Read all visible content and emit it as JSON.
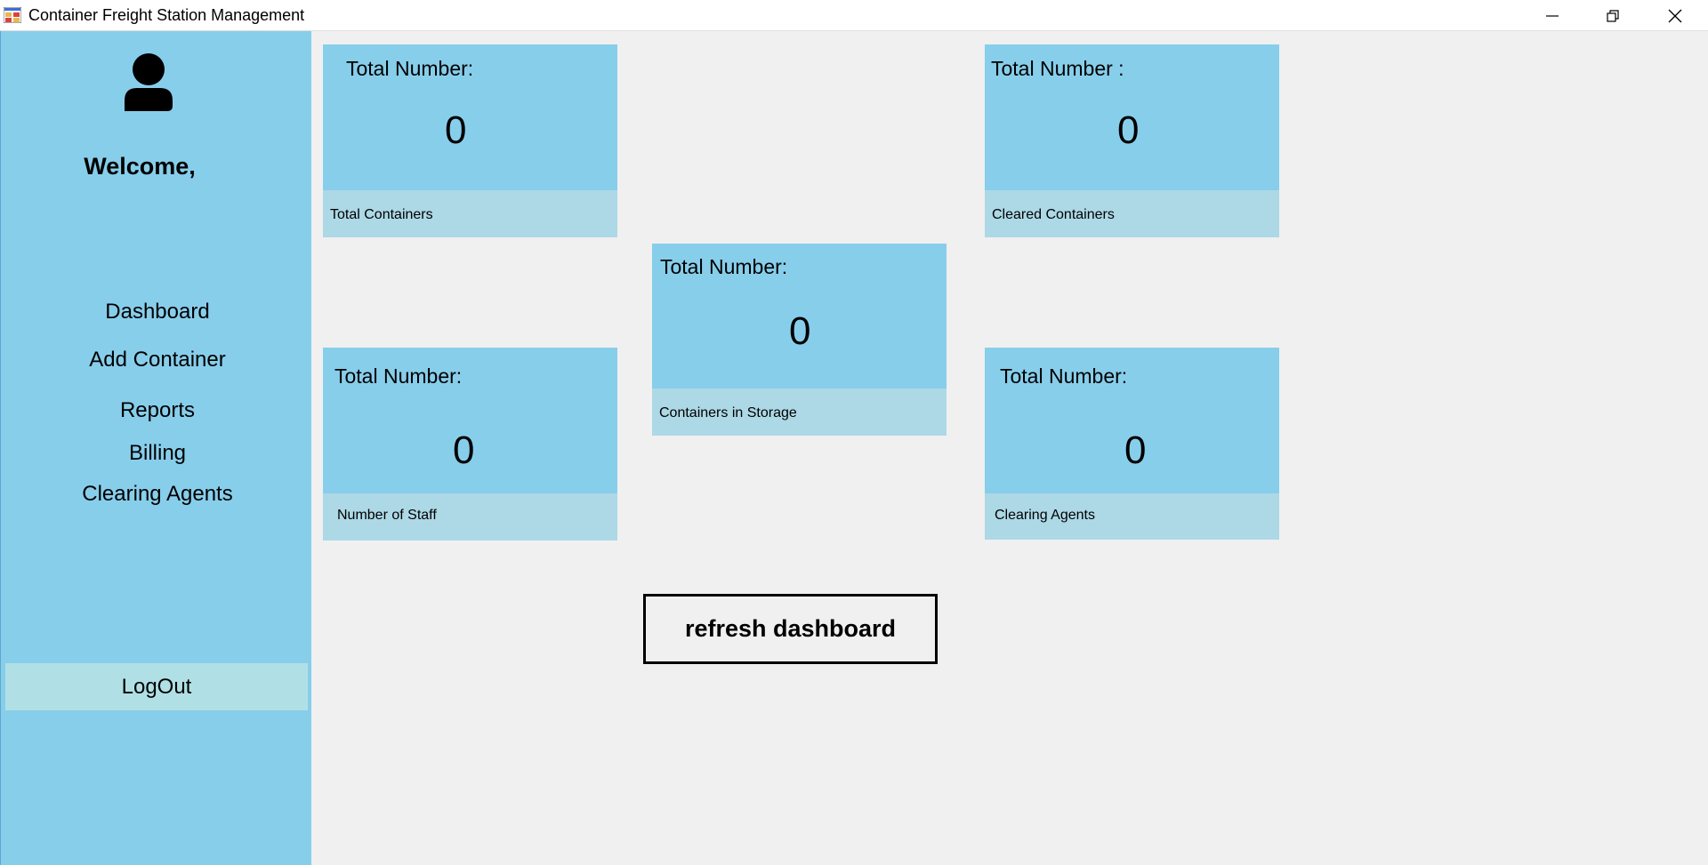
{
  "window": {
    "title": "Container Freight Station Management",
    "icon": "app-icon"
  },
  "sidebar": {
    "welcome": "Welcome,",
    "avatar_icon": "user-icon",
    "nav": [
      {
        "label": "Dashboard"
      },
      {
        "label": "Add Container"
      },
      {
        "label": "Reports"
      },
      {
        "label": "Billing"
      },
      {
        "label": "Clearing Agents"
      }
    ],
    "logout": "LogOut"
  },
  "cards": [
    {
      "header": "Total Number:",
      "value": "0",
      "caption": "Total Containers"
    },
    {
      "header": "Total Number :",
      "value": "0",
      "caption": "Cleared Containers"
    },
    {
      "header": "Total Number:",
      "value": "0",
      "caption": "Containers in Storage"
    },
    {
      "header": "Total Number:",
      "value": "0",
      "caption": "Number of Staff"
    },
    {
      "header": "Total Number:",
      "value": "0",
      "caption": "Clearing Agents"
    }
  ],
  "refresh_button": "refresh dashboard",
  "colors": {
    "sidebar": "#87ceeb",
    "card": "#87ceeb",
    "card_footer": "#add8e6",
    "logout_bg": "#b0e0e6",
    "background": "#f0f0f0"
  }
}
